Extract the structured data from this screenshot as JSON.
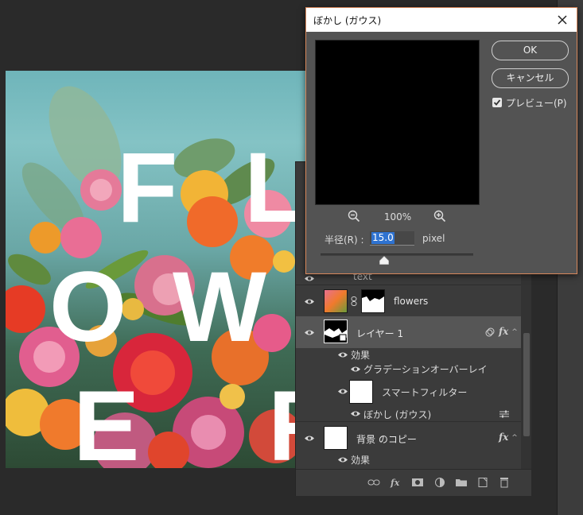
{
  "blur_dialog": {
    "title": "ぼかし (ガウス)",
    "ok_label": "OK",
    "cancel_label": "キャンセル",
    "preview_label": "プレビュー(P)",
    "preview_checked": true,
    "zoom_percent": "100%",
    "radius_label": "半径(R) :",
    "radius_value": "15.0",
    "radius_unit": "pixel",
    "accent_color": "#d7875b",
    "selection_color": "#2f73d1"
  },
  "canvas": {
    "letters": [
      "F",
      "L",
      "O",
      "W",
      "E",
      "R"
    ]
  },
  "layers": {
    "partial_row_label": "text",
    "items": [
      {
        "name": "flowers"
      },
      {
        "name": "レイヤー 1",
        "fx": "fx"
      },
      {
        "name": "背景 のコピー",
        "fx": "fx"
      }
    ],
    "effects_label": "効果",
    "gradient_overlay_label": "グラデーションオーバーレイ",
    "smart_filter_label": "スマートフィルター",
    "blur_filter_label": "ぼかし (ガウス)",
    "bg_effects_label": "効果"
  },
  "footer_icons": [
    "link-icon",
    "fx-icon",
    "mask-icon",
    "adjustment-icon",
    "folder-icon",
    "new-layer-icon",
    "trash-icon"
  ]
}
